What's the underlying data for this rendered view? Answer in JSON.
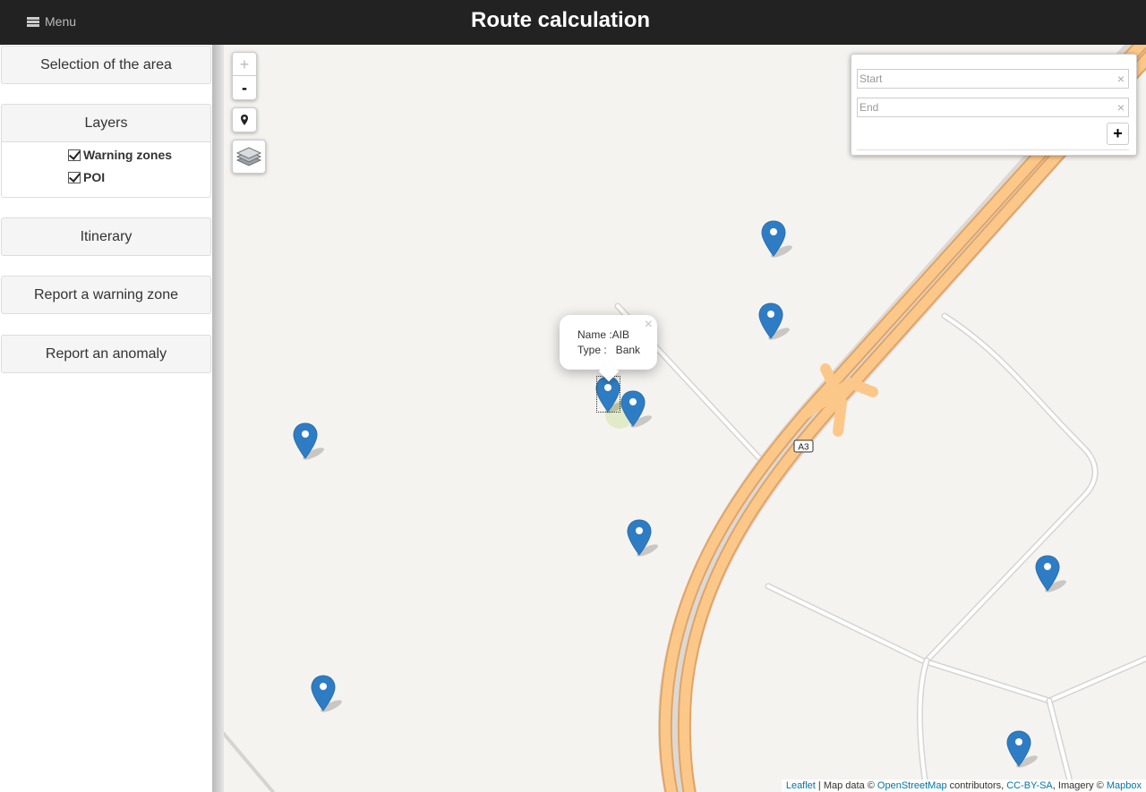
{
  "header": {
    "menu_label": "Menu",
    "title": "Route calculation"
  },
  "sidebar": {
    "selection_label": "Selection of the area",
    "layers_label": "Layers",
    "layers": [
      {
        "label": "Warning zones",
        "checked": true
      },
      {
        "label": "POI",
        "checked": true
      }
    ],
    "itinerary_label": "Itinerary",
    "report_warning_label": "Report a warning zone",
    "report_anomaly_label": "Report an anomaly"
  },
  "map": {
    "zoom_in": "+",
    "zoom_out": "-",
    "road_label": "A3",
    "routing": {
      "start_placeholder": "Start",
      "end_placeholder": "End",
      "clear_symbol": "×",
      "add_symbol": "+"
    },
    "popup": {
      "close_symbol": "×",
      "name_line": "Name :AIB",
      "type_line": "Type :   Bank"
    },
    "attribution": {
      "leaflet": "Leaflet",
      "sep1": " | Map data © ",
      "osm": "OpenStreetMap",
      "sep2": " contributors, ",
      "license": "CC-BY-SA",
      "sep3": ", Imagery © ",
      "mapbox": "Mapbox"
    }
  },
  "colors": {
    "topbar": "#222222",
    "marker": "#2e7dc4",
    "motorway": "#fcc88a",
    "link": "#0078a8"
  },
  "icons": {
    "menu": "list-icon",
    "locate": "map-pin-icon",
    "layers": "layers-icon",
    "marker": "map-marker-icon"
  }
}
